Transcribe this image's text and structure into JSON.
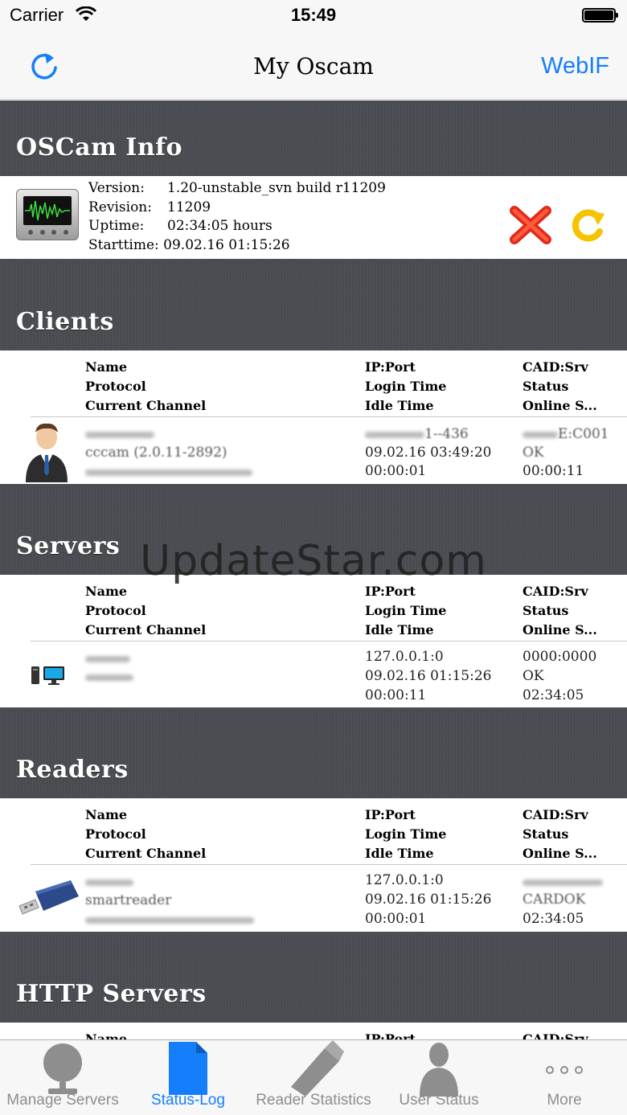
{
  "status_bar": {
    "carrier": "Carrier",
    "time": "15:49"
  },
  "nav": {
    "title": "My Oscam",
    "right_button": "WebIF"
  },
  "sections": {
    "info": "OSCam Info",
    "clients": "Clients",
    "servers": "Servers",
    "readers": "Readers",
    "http": "HTTP Servers"
  },
  "info": {
    "version_label": "Version:",
    "version": "1.20-unstable_svn build r11209",
    "revision_label": "Revision:",
    "revision": "11209",
    "uptime_label": "Uptime:",
    "uptime": "02:34:05 hours",
    "starttime_label": "Starttime:",
    "starttime": "09.02.16 01:15:26"
  },
  "headers": {
    "name": "Name",
    "protocol": "Protocol",
    "channel": "Current Channel",
    "ipport": "IP:Port",
    "login": "Login Time",
    "idle": "Idle Time",
    "caid": "CAID:Srv",
    "status": "Status",
    "online": "Online S..."
  },
  "clients": {
    "protocol": "cccam (2.0.11-2892)",
    "ip_tail": "1--436",
    "login": "09.02.16 03:49:20",
    "idle": "00:00:01",
    "caid_tail": "E:C001",
    "status": "OK",
    "online": "00:00:11"
  },
  "servers": {
    "ip": "127.0.0.1:0",
    "login": "09.02.16 01:15:26",
    "idle": "00:00:11",
    "caid": "0000:0000",
    "status": "OK",
    "online": "02:34:05"
  },
  "readers": {
    "protocol": "smartreader",
    "ip": "127.0.0.1:0",
    "login": "09.02.16 01:15:26",
    "idle": "00:00:01",
    "status": "CARDOK",
    "online": "02:34:05"
  },
  "http_partial": {
    "name": "Name",
    "ipport": "IP:Port",
    "caid": "CAID:Srv"
  },
  "tabs": [
    {
      "label": "Manage Servers",
      "icon": "globe-icon",
      "active": false
    },
    {
      "label": "Status-Log",
      "icon": "document-icon",
      "active": true
    },
    {
      "label": "Reader Statistics",
      "icon": "usb-stick-icon",
      "active": false
    },
    {
      "label": "User Status",
      "icon": "user-icon",
      "active": false
    },
    {
      "label": "More",
      "icon": "more-icon",
      "active": false
    }
  ],
  "watermark": "UpdateStar.com",
  "colors": {
    "accent": "#147efb",
    "section_bg": "#4a4d52"
  }
}
